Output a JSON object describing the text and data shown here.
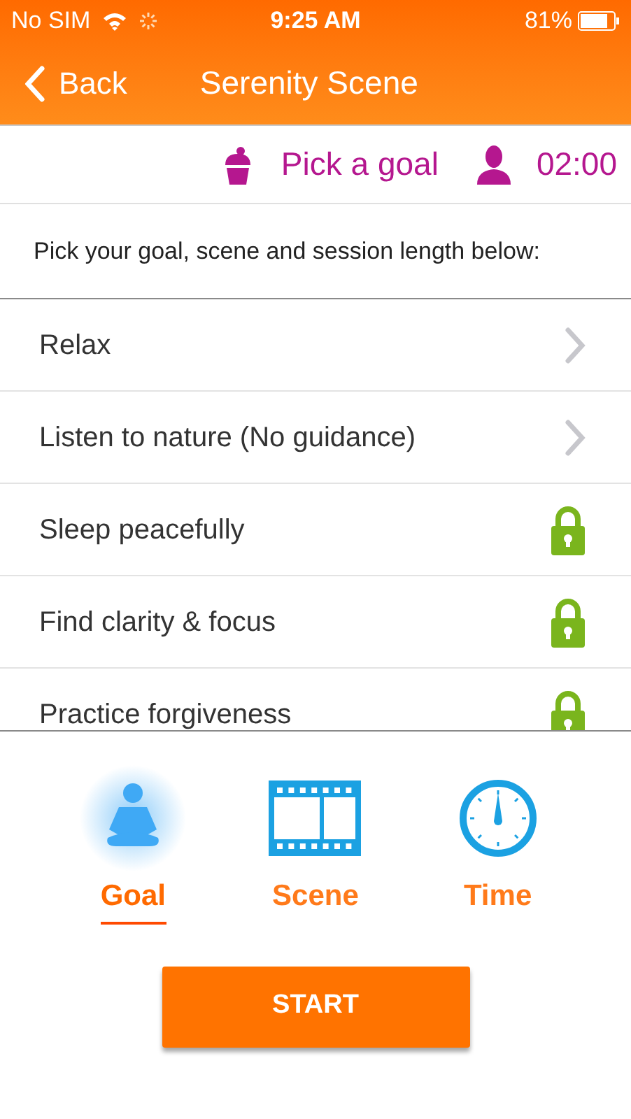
{
  "status_bar": {
    "carrier": "No SIM",
    "time": "9:25 AM",
    "battery": "81%"
  },
  "nav": {
    "back": "Back",
    "title": "Serenity Scene"
  },
  "info": {
    "goal": "Pick a goal",
    "time": "02:00"
  },
  "instructions": "Pick your goal, scene and session length below:",
  "goals": [
    {
      "label": "Relax",
      "kind": "arrow"
    },
    {
      "label": "Listen to nature (No guidance)",
      "kind": "arrow"
    },
    {
      "label": "Sleep peacefully",
      "kind": "locked"
    },
    {
      "label": "Find clarity & focus",
      "kind": "locked"
    },
    {
      "label": "Practice forgiveness",
      "kind": "locked"
    }
  ],
  "tabs": [
    {
      "label": "Goal",
      "kind": "goal",
      "selected": true
    },
    {
      "label": "Scene",
      "kind": "scene",
      "selected": false
    },
    {
      "label": "Time",
      "kind": "time",
      "selected": false
    }
  ],
  "start_button": "START"
}
